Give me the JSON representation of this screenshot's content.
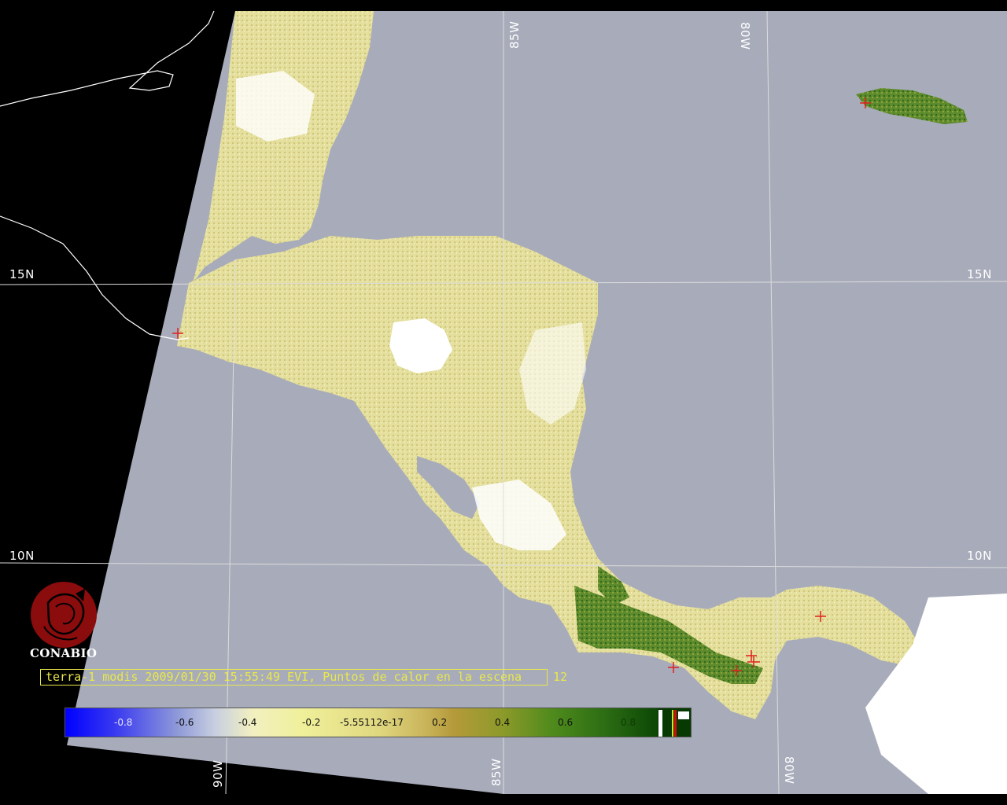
{
  "grid": {
    "lat_labels_left": [
      "15N",
      "10N"
    ],
    "lat_labels_right": [
      "15N",
      "10N"
    ],
    "lon_labels_top": [
      "85W",
      "80W"
    ],
    "lon_labels_bottom": [
      "90W",
      "85W",
      "80W"
    ]
  },
  "caption": {
    "text": "terra-1 modis 2009/01/30 15:55:49 EVI, Puntos de calor en la escena",
    "count": "12"
  },
  "colorbar": {
    "ticks": [
      "-0.8",
      "-0.6",
      "-0.4",
      "-0.2",
      "-5.55112e-17",
      "0.2",
      "0.4",
      "0.6",
      "0.8"
    ]
  },
  "logo": {
    "text": "CONABIO"
  },
  "colors": {
    "background": "#000000",
    "sea": "#a8acba",
    "land_low": "#e6e29a",
    "land_high": "#2f6e1c",
    "cloud": "#ffffff",
    "hotspot": "#e02020",
    "caption": "#e8e84a",
    "logo": "#8b0c0c"
  },
  "icons": [
    "hotspot-cross-icon",
    "conabio-logo-icon"
  ]
}
